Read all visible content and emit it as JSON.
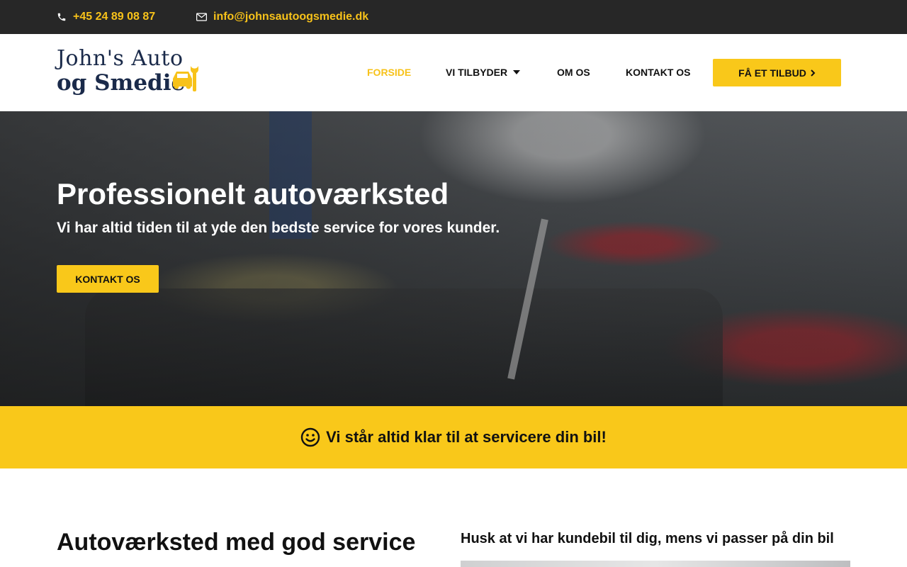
{
  "topbar": {
    "phone": "+45 24 89 08 87",
    "email": "info@johnsautoogsmedie.dk",
    "phone_icon": "phone-icon",
    "email_icon": "envelope-icon"
  },
  "logo": {
    "line1": "John's Auto",
    "line2": "og Smedie"
  },
  "nav": {
    "items": [
      {
        "label": "FORSIDE",
        "active": true
      },
      {
        "label": "VI TILBYDER",
        "dropdown": true
      },
      {
        "label": "OM OS"
      },
      {
        "label": "KONTAKT OS"
      }
    ],
    "cta": "FÅ ET TILBUD"
  },
  "hero": {
    "title": "Professionelt autoværksted",
    "subtitle": "Vi har altid tiden til at yde den bedste service for vores kunder.",
    "button": "KONTAKT OS"
  },
  "band": {
    "text": "Vi står altid klar til at servicere din bil!",
    "icon": "smiley-icon"
  },
  "content": {
    "heading": "Autoværksted med god service",
    "subheading": "Husk at vi har kundebil til dig, mens vi passer på din bil"
  },
  "colors": {
    "accent": "#f9c81a",
    "topbar_bg": "#272727",
    "logo_navy": "#1a2a4a"
  }
}
